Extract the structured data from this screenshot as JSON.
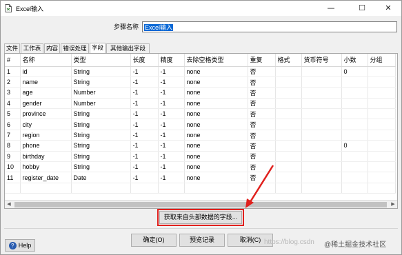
{
  "window": {
    "title": "Excel输入"
  },
  "window_controls": {
    "minimize": "—",
    "maximize": "☐",
    "close": "✕"
  },
  "step": {
    "label": "步骤名称",
    "value": "Excel输入"
  },
  "tabs": [
    "文件",
    "工作表",
    "内容",
    "错误处理",
    "字段",
    "其他输出字段"
  ],
  "active_tab": "字段",
  "table": {
    "columns": [
      "#",
      "名称",
      "类型",
      "长度",
      "精度",
      "去除空格类型",
      "重复",
      "格式",
      "货币符号",
      "小数",
      "分组"
    ],
    "rows": [
      [
        "1",
        "id",
        "String",
        "-1",
        "-1",
        "none",
        "否",
        "",
        "",
        "0",
        ""
      ],
      [
        "2",
        "name",
        "String",
        "-1",
        "-1",
        "none",
        "否",
        "",
        "",
        "",
        ""
      ],
      [
        "3",
        "age",
        "Number",
        "-1",
        "-1",
        "none",
        "否",
        "",
        "",
        "",
        ""
      ],
      [
        "4",
        "gender",
        "Number",
        "-1",
        "-1",
        "none",
        "否",
        "",
        "",
        "",
        ""
      ],
      [
        "5",
        "province",
        "String",
        "-1",
        "-1",
        "none",
        "否",
        "",
        "",
        "",
        ""
      ],
      [
        "6",
        "city",
        "String",
        "-1",
        "-1",
        "none",
        "否",
        "",
        "",
        "",
        ""
      ],
      [
        "7",
        "region",
        "String",
        "-1",
        "-1",
        "none",
        "否",
        "",
        "",
        "",
        ""
      ],
      [
        "8",
        "phone",
        "String",
        "-1",
        "-1",
        "none",
        "否",
        "",
        "",
        "0",
        ""
      ],
      [
        "9",
        "birthday",
        "String",
        "-1",
        "-1",
        "none",
        "否",
        "",
        "",
        "",
        ""
      ],
      [
        "10",
        "hobby",
        "String",
        "-1",
        "-1",
        "none",
        "否",
        "",
        "",
        "",
        ""
      ],
      [
        "11",
        "register_date",
        "Date",
        "-1",
        "-1",
        "none",
        "否",
        "",
        "",
        "",
        ""
      ]
    ]
  },
  "buttons": {
    "get_fields": "获取来自头部数据的字段...",
    "ok": "确定(O)",
    "preview": "预览记录",
    "cancel": "取消(C)",
    "help": "Help"
  },
  "watermark": {
    "url": "https://blog.csdn",
    "brand": "@稀土掘金技术社区"
  },
  "colors": {
    "annotation": "#e0201d",
    "selection": "#0a68d6"
  }
}
